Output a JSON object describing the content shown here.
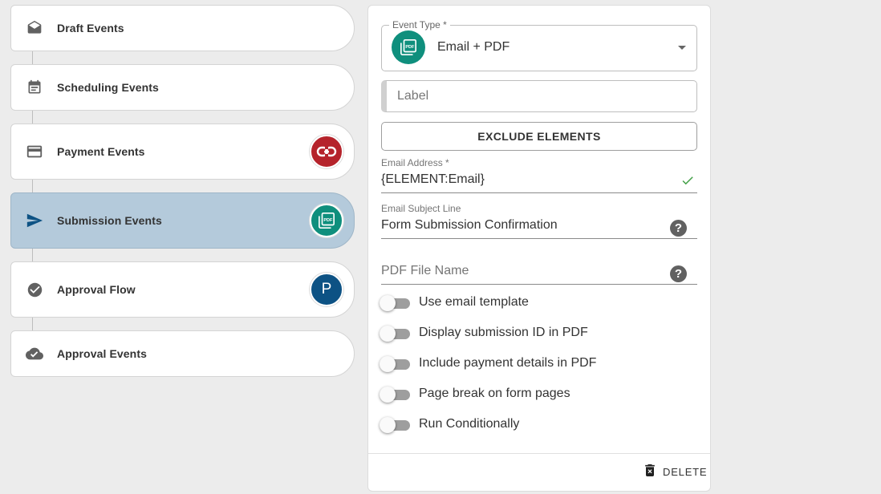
{
  "sidebar": {
    "steps": [
      {
        "label": "Draft Events",
        "icon": "envelope-open-icon"
      },
      {
        "label": "Scheduling Events",
        "icon": "calendar-icon"
      },
      {
        "label": "Payment Events",
        "icon": "credit-card-icon",
        "badge": "payment-link-icon"
      },
      {
        "label": "Submission Events",
        "icon": "send-icon",
        "badge": "pdf-icon",
        "active": true
      },
      {
        "label": "Approval Flow",
        "icon": "check-circle-icon",
        "badge_text": "P"
      },
      {
        "label": "Approval Events",
        "icon": "cloud-done-icon"
      }
    ]
  },
  "event": {
    "type_label": "Event Type *",
    "type_value": "Email + PDF",
    "label_placeholder": "Label",
    "exclude_button": "EXCLUDE ELEMENTS",
    "email_address_label": "Email Address *",
    "email_address_value": "{ELEMENT:Email}",
    "subject_label": "Email Subject Line",
    "subject_value": "Form Submission Confirmation",
    "pdf_filename_placeholder": "PDF File Name",
    "toggles": [
      {
        "label": "Use email template",
        "on": false
      },
      {
        "label": "Display submission ID in PDF",
        "on": false
      },
      {
        "label": "Include payment details in PDF",
        "on": false
      },
      {
        "label": "Page break on form pages",
        "on": false
      },
      {
        "label": "Run Conditionally",
        "on": false
      }
    ],
    "delete_label": "DELETE"
  },
  "colors": {
    "active_step": "#b4cadb",
    "teal": "#0f8f7d",
    "red": "#b5232b",
    "blue": "#0d5284",
    "valid_check": "#43a047"
  }
}
